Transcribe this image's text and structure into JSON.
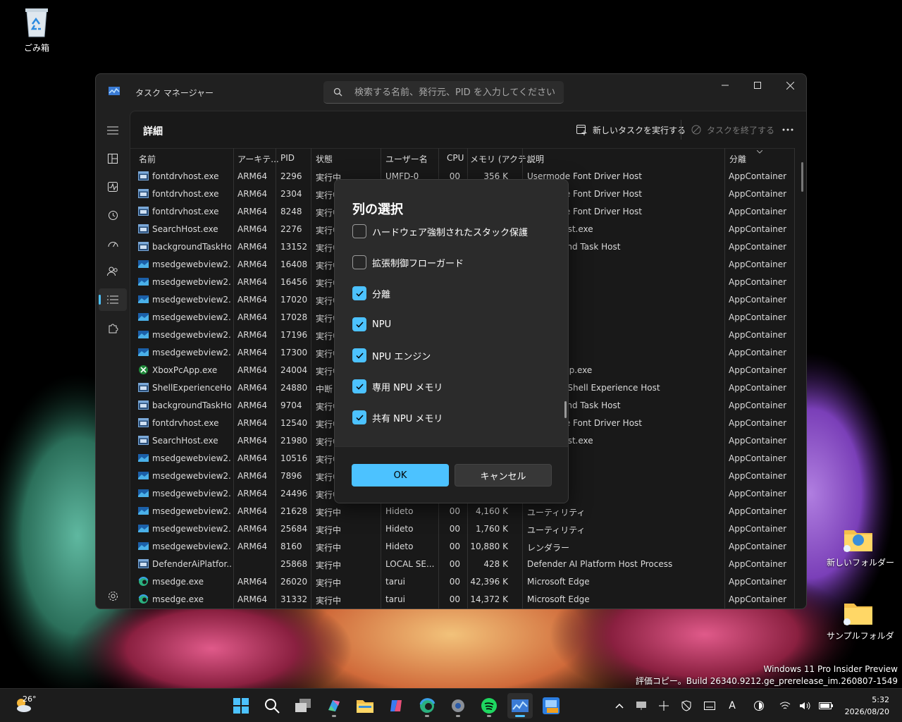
{
  "desktop": {
    "icons": [
      {
        "label": "ごみ箱"
      },
      {
        "label": "新しいフォルダー"
      },
      {
        "label": "サンプルフォルダ"
      }
    ],
    "watermark": {
      "line1": "Windows 11 Pro Insider Preview",
      "line2": "評価コピー。Build 26340.9212.ge_prerelease_im.260807-1549"
    }
  },
  "window": {
    "title": "タスク マネージャー",
    "search_placeholder": "検索する名前、発行元、PID を入力してください",
    "page_title": "詳細",
    "commands": {
      "run_new_task": "新しいタスクを実行する",
      "end_task": "タスクを終了する"
    },
    "columns": [
      "名前",
      "アーキテ...",
      "PID",
      "状態",
      "ユーザー名",
      "CPU",
      "メモリ (アクテ...",
      "説明",
      "分離"
    ],
    "rows": [
      {
        "name": "fontdrvhost.exe",
        "icon": "window",
        "arch": "ARM64",
        "pid": "2296",
        "status": "実行中",
        "user": "UMFD-0",
        "cpu": "00",
        "mem": "356 K",
        "desc": "Usermode Font Driver Host",
        "iso": "AppContainer"
      },
      {
        "name": "fontdrvhost.exe",
        "icon": "window",
        "arch": "ARM64",
        "pid": "2304",
        "status": "実行中",
        "user": "",
        "cpu": "",
        "mem": "",
        "desc": "Usermode Font Driver Host",
        "iso": "AppContainer"
      },
      {
        "name": "fontdrvhost.exe",
        "icon": "window",
        "arch": "ARM64",
        "pid": "8248",
        "status": "実行中",
        "user": "",
        "cpu": "",
        "mem": "",
        "desc": "Usermode Font Driver Host",
        "iso": "AppContainer"
      },
      {
        "name": "SearchHost.exe",
        "icon": "window",
        "arch": "ARM64",
        "pid": "2276",
        "status": "実行中",
        "user": "",
        "cpu": "",
        "mem": "",
        "desc": "SearchHost.exe",
        "iso": "AppContainer"
      },
      {
        "name": "backgroundTaskHo...",
        "icon": "window",
        "arch": "ARM64",
        "pid": "13152",
        "status": "実行中",
        "user": "",
        "cpu": "",
        "mem": "",
        "desc": "Background Task Host",
        "iso": "AppContainer"
      },
      {
        "name": "msedgewebview2.e...",
        "icon": "webview",
        "arch": "ARM64",
        "pid": "16408",
        "status": "実行中",
        "user": "",
        "cpu": "",
        "mem": "",
        "desc": "",
        "iso": "AppContainer"
      },
      {
        "name": "msedgewebview2.e...",
        "icon": "webview",
        "arch": "ARM64",
        "pid": "16456",
        "status": "実行中",
        "user": "",
        "cpu": "",
        "mem": "",
        "desc": "",
        "iso": "AppContainer"
      },
      {
        "name": "msedgewebview2.e...",
        "icon": "webview",
        "arch": "ARM64",
        "pid": "17020",
        "status": "実行中",
        "user": "",
        "cpu": "",
        "mem": "",
        "desc": "",
        "iso": "AppContainer"
      },
      {
        "name": "msedgewebview2.e...",
        "icon": "webview",
        "arch": "ARM64",
        "pid": "17028",
        "status": "実行中",
        "user": "",
        "cpu": "",
        "mem": "",
        "desc": "",
        "iso": "AppContainer"
      },
      {
        "name": "msedgewebview2.e...",
        "icon": "webview",
        "arch": "ARM64",
        "pid": "17196",
        "status": "実行中",
        "user": "",
        "cpu": "",
        "mem": "",
        "desc": "",
        "iso": "AppContainer"
      },
      {
        "name": "msedgewebview2.e...",
        "icon": "webview",
        "arch": "ARM64",
        "pid": "17300",
        "status": "実行中",
        "user": "",
        "cpu": "",
        "mem": "",
        "desc": "",
        "iso": "AppContainer"
      },
      {
        "name": "XboxPcApp.exe",
        "icon": "xbox",
        "arch": "ARM64",
        "pid": "24004",
        "status": "実行中",
        "user": "",
        "cpu": "",
        "mem": "",
        "desc": "XboxPcApp.exe",
        "iso": "AppContainer"
      },
      {
        "name": "ShellExperienceHo...",
        "icon": "window",
        "arch": "ARM64",
        "pid": "24880",
        "status": "中断",
        "user": "",
        "cpu": "",
        "mem": "",
        "desc": "Windows Shell Experience Host",
        "iso": "AppContainer"
      },
      {
        "name": "backgroundTaskHo...",
        "icon": "window",
        "arch": "ARM64",
        "pid": "9704",
        "status": "実行中",
        "user": "",
        "cpu": "",
        "mem": "",
        "desc": "Background Task Host",
        "iso": "AppContainer"
      },
      {
        "name": "fontdrvhost.exe",
        "icon": "window",
        "arch": "ARM64",
        "pid": "12540",
        "status": "実行中",
        "user": "",
        "cpu": "",
        "mem": "",
        "desc": "Usermode Font Driver Host",
        "iso": "AppContainer"
      },
      {
        "name": "SearchHost.exe",
        "icon": "window",
        "arch": "ARM64",
        "pid": "21980",
        "status": "実行中",
        "user": "",
        "cpu": "",
        "mem": "",
        "desc": "SearchHost.exe",
        "iso": "AppContainer"
      },
      {
        "name": "msedgewebview2.e...",
        "icon": "webview",
        "arch": "ARM64",
        "pid": "10516",
        "status": "実行中",
        "user": "",
        "cpu": "",
        "mem": "",
        "desc": "",
        "iso": "AppContainer"
      },
      {
        "name": "msedgewebview2.e...",
        "icon": "webview",
        "arch": "ARM64",
        "pid": "7896",
        "status": "実行中",
        "user": "",
        "cpu": "",
        "mem": "",
        "desc": "",
        "iso": "AppContainer"
      },
      {
        "name": "msedgewebview2.e...",
        "icon": "webview",
        "arch": "ARM64",
        "pid": "24496",
        "status": "実行中",
        "user": "",
        "cpu": "",
        "mem": "",
        "desc": "",
        "iso": "AppContainer"
      },
      {
        "name": "msedgewebview2.e...",
        "icon": "webview",
        "arch": "ARM64",
        "pid": "21628",
        "status": "実行中",
        "user": "Hideto",
        "cpu": "00",
        "mem": "4,160 K",
        "desc": "ユーティリティ",
        "iso": "AppContainer"
      },
      {
        "name": "msedgewebview2.e...",
        "icon": "webview",
        "arch": "ARM64",
        "pid": "25684",
        "status": "実行中",
        "user": "Hideto",
        "cpu": "00",
        "mem": "1,760 K",
        "desc": "ユーティリティ",
        "iso": "AppContainer"
      },
      {
        "name": "msedgewebview2.e...",
        "icon": "webview",
        "arch": "ARM64",
        "pid": "8160",
        "status": "実行中",
        "user": "Hideto",
        "cpu": "00",
        "mem": "10,880 K",
        "desc": "レンダラー",
        "iso": "AppContainer"
      },
      {
        "name": "DefenderAiPlatfor...",
        "icon": "window",
        "arch": "",
        "pid": "25868",
        "status": "実行中",
        "user": "LOCAL SE...",
        "cpu": "00",
        "mem": "428 K",
        "desc": "Defender AI Platform Host Process",
        "iso": "AppContainer"
      },
      {
        "name": "msedge.exe",
        "icon": "edge",
        "arch": "ARM64",
        "pid": "26020",
        "status": "実行中",
        "user": "tarui",
        "cpu": "00",
        "mem": "42,396 K",
        "desc": "Microsoft Edge",
        "iso": "AppContainer"
      },
      {
        "name": "msedge.exe",
        "icon": "edge",
        "arch": "ARM64",
        "pid": "31332",
        "status": "実行中",
        "user": "tarui",
        "cpu": "00",
        "mem": "14,372 K",
        "desc": "Microsoft Edge",
        "iso": "AppContainer"
      }
    ]
  },
  "dialog": {
    "title": "列の選択",
    "options": [
      {
        "label": "ハードウェア強制されたスタック保護",
        "checked": false
      },
      {
        "label": "拡張制御フローガード",
        "checked": false
      },
      {
        "label": "分離",
        "checked": true
      },
      {
        "label": "NPU",
        "checked": true
      },
      {
        "label": "NPU エンジン",
        "checked": true
      },
      {
        "label": "専用 NPU メモリ",
        "checked": true
      },
      {
        "label": "共有 NPU メモリ",
        "checked": true
      }
    ],
    "ok_label": "OK",
    "cancel_label": "キャンセル"
  },
  "taskbar": {
    "weather_temp": "26°",
    "clock_time": "5:32",
    "clock_date": "2026/08/20",
    "ime_label": "A",
    "accent": "#4cc2ff"
  }
}
